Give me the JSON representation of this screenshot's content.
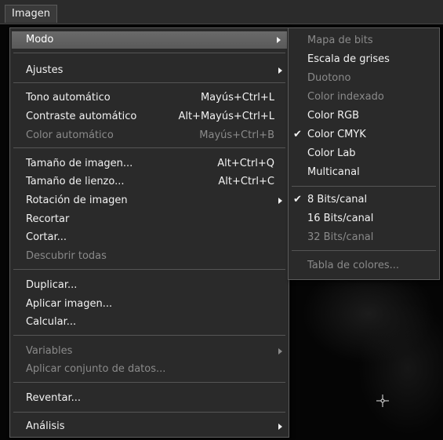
{
  "menubar": {
    "label": "Imagen"
  },
  "main_menu": {
    "items": [
      {
        "label": "Modo",
        "shortcut": "",
        "submenu": true,
        "disabled": false,
        "highlighted": true
      },
      {
        "label": "Ajustes",
        "shortcut": "",
        "submenu": true,
        "disabled": false
      },
      {
        "label": "Tono automático",
        "shortcut": "Mayús+Ctrl+L",
        "submenu": false,
        "disabled": false
      },
      {
        "label": "Contraste automático",
        "shortcut": "Alt+Mayús+Ctrl+L",
        "submenu": false,
        "disabled": false
      },
      {
        "label": "Color automático",
        "shortcut": "Mayús+Ctrl+B",
        "submenu": false,
        "disabled": true
      },
      {
        "label": "Tamaño de imagen...",
        "shortcut": "Alt+Ctrl+Q",
        "submenu": false,
        "disabled": false
      },
      {
        "label": "Tamaño de lienzo...",
        "shortcut": "Alt+Ctrl+C",
        "submenu": false,
        "disabled": false
      },
      {
        "label": "Rotación de imagen",
        "shortcut": "",
        "submenu": true,
        "disabled": false
      },
      {
        "label": "Recortar",
        "shortcut": "",
        "submenu": false,
        "disabled": false
      },
      {
        "label": "Cortar...",
        "shortcut": "",
        "submenu": false,
        "disabled": false
      },
      {
        "label": "Descubrir todas",
        "shortcut": "",
        "submenu": false,
        "disabled": true
      },
      {
        "label": "Duplicar...",
        "shortcut": "",
        "submenu": false,
        "disabled": false
      },
      {
        "label": "Aplicar imagen...",
        "shortcut": "",
        "submenu": false,
        "disabled": false
      },
      {
        "label": "Calcular...",
        "shortcut": "",
        "submenu": false,
        "disabled": false
      },
      {
        "label": "Variables",
        "shortcut": "",
        "submenu": true,
        "disabled": true
      },
      {
        "label": "Aplicar conjunto de datos...",
        "shortcut": "",
        "submenu": false,
        "disabled": true
      },
      {
        "label": "Reventar...",
        "shortcut": "",
        "submenu": false,
        "disabled": false
      },
      {
        "label": "Análisis",
        "shortcut": "",
        "submenu": true,
        "disabled": false
      }
    ]
  },
  "sub_menu": {
    "items": [
      {
        "label": "Mapa de bits",
        "checked": false,
        "disabled": true
      },
      {
        "label": "Escala de grises",
        "checked": false,
        "disabled": false
      },
      {
        "label": "Duotono",
        "checked": false,
        "disabled": true
      },
      {
        "label": "Color indexado",
        "checked": false,
        "disabled": true
      },
      {
        "label": "Color RGB",
        "checked": false,
        "disabled": false
      },
      {
        "label": "Color CMYK",
        "checked": true,
        "disabled": false
      },
      {
        "label": "Color Lab",
        "checked": false,
        "disabled": false
      },
      {
        "label": "Multicanal",
        "checked": false,
        "disabled": false
      },
      {
        "label": "8 Bits/canal",
        "checked": true,
        "disabled": false
      },
      {
        "label": "16 Bits/canal",
        "checked": false,
        "disabled": false
      },
      {
        "label": "32 Bits/canal",
        "checked": false,
        "disabled": true
      },
      {
        "label": "Tabla de colores...",
        "checked": false,
        "disabled": true
      }
    ]
  },
  "check_glyph": "✔"
}
